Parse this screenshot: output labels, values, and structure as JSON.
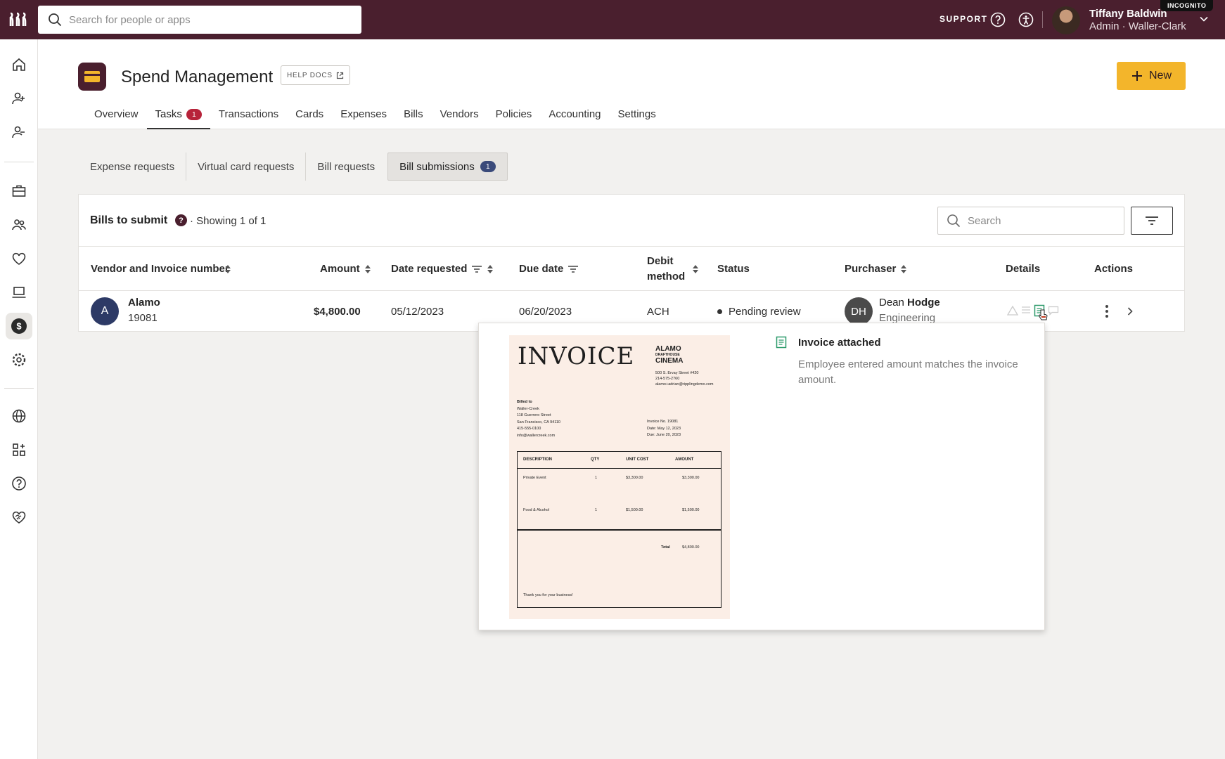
{
  "topbar": {
    "search_placeholder": "Search for people or apps",
    "support_label": "SUPPORT",
    "user_name": "Tiffany Baldwin",
    "user_role": "Admin · Waller-Clark",
    "incognito_label": "INCOGNITO"
  },
  "sidebar": {
    "items": [
      "home-icon",
      "add-person-icon",
      "remove-person-icon",
      "briefcase-icon",
      "people-icon",
      "heart-icon",
      "laptop-icon",
      "dollar-icon",
      "gear-icon",
      "globe-icon",
      "apps-icon",
      "help-icon",
      "handshake-icon"
    ],
    "active": "dollar-icon"
  },
  "header": {
    "app_title": "Spend Management",
    "help_docs_label": "HELP DOCS",
    "new_button_label": "New",
    "tabs": [
      {
        "label": "Overview"
      },
      {
        "label": "Tasks",
        "badge": "1",
        "active": true
      },
      {
        "label": "Transactions"
      },
      {
        "label": "Cards"
      },
      {
        "label": "Expenses"
      },
      {
        "label": "Bills"
      },
      {
        "label": "Vendors"
      },
      {
        "label": "Policies"
      },
      {
        "label": "Accounting"
      },
      {
        "label": "Settings"
      }
    ]
  },
  "subtabs": [
    {
      "label": "Expense requests"
    },
    {
      "label": "Virtual card requests"
    },
    {
      "label": "Bill requests"
    },
    {
      "label": "Bill submissions",
      "badge": "1",
      "active": true
    }
  ],
  "panel": {
    "title": "Bills to submit",
    "showing": "· Showing 1 of 1",
    "search_placeholder": "Search",
    "columns": [
      "Vendor and Invoice number",
      "Amount",
      "Date requested",
      "Due date",
      "Debit method",
      "Status",
      "Purchaser",
      "Details",
      "Actions"
    ],
    "row": {
      "vendor_initial": "A",
      "vendor_name": "Alamo",
      "invoice_number": "19081",
      "amount": "$4,800.00",
      "date_requested": "05/12/2023",
      "due_date": "06/20/2023",
      "debit_method": "ACH",
      "status": "Pending review",
      "purchaser_initials": "DH",
      "purchaser_first": "Dean",
      "purchaser_last": "Hodge",
      "purchaser_dept": "Engineering"
    }
  },
  "popover": {
    "title": "Invoice attached",
    "text": "Employee entered amount matches the invoice amount.",
    "invoice": {
      "heading": "INVOICE",
      "brand_line1": "ALAMO",
      "brand_line2": "DRAFTHOUSE",
      "brand_line3": "CINEMA",
      "addr1": "500 S. Ervay Street #420",
      "addr2": "214-575-2760",
      "addr3": "alamo+adrian@ripplingdemo.com",
      "billed_label": "Billed to",
      "billed1": "Waller-Creek",
      "billed2": "118 Guerrero Street",
      "billed3": "San Francisco, CA 94110",
      "billed4": "415-555-0100",
      "billed5": "info@wallercreek.com",
      "meta1": "Invoice No. 19081",
      "meta2": "Date: May 12, 2023",
      "meta3": "Due: June 20, 2023",
      "col_desc": "DESCRIPTION",
      "col_qty": "QTY",
      "col_unit": "UNIT COST",
      "col_amount": "AMOUNT",
      "items": [
        {
          "desc": "Private Event",
          "qty": "1",
          "unit": "$3,300.00",
          "amount": "$3,300.00"
        },
        {
          "desc": "Food & Alcohol",
          "qty": "1",
          "unit": "$1,500.00",
          "amount": "$1,500.00"
        }
      ],
      "total_label": "Total",
      "total_value": "$4,800.00",
      "thanks": "Thank you for your business!"
    }
  },
  "colors": {
    "brand": "#4a1f2e",
    "accent": "#f3b52b",
    "badge_red": "#b7233a",
    "badge_blue": "#3a4a7a"
  }
}
